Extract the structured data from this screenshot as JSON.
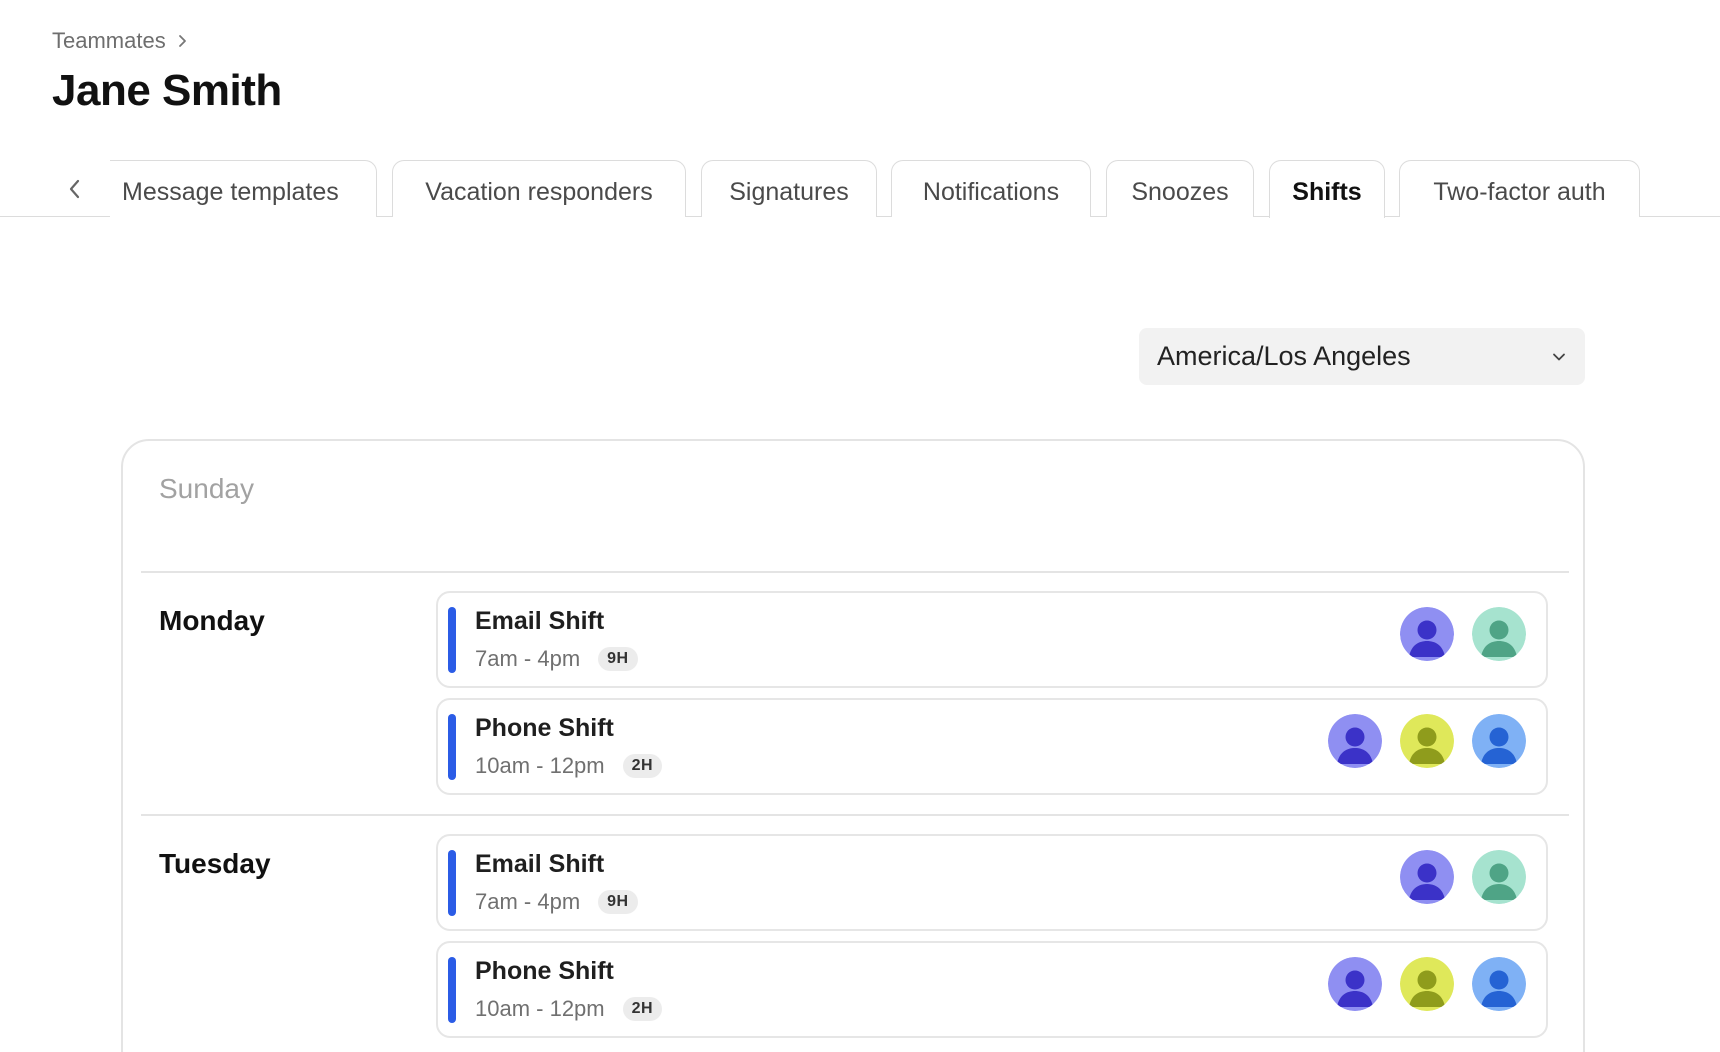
{
  "breadcrumb": {
    "parent": "Teammates"
  },
  "page": {
    "title": "Jane Smith"
  },
  "tabs": [
    {
      "label": "Message templates",
      "active": false
    },
    {
      "label": "Vacation responders",
      "active": false
    },
    {
      "label": "Signatures",
      "active": false
    },
    {
      "label": "Notifications",
      "active": false
    },
    {
      "label": "Snoozes",
      "active": false
    },
    {
      "label": "Shifts",
      "active": true
    },
    {
      "label": "Two-factor auth",
      "active": false
    }
  ],
  "timezone": {
    "value": "America/Los Angeles"
  },
  "schedule": {
    "days": [
      {
        "name": "Sunday",
        "shifts": []
      },
      {
        "name": "Monday",
        "shifts": [
          {
            "title": "Email Shift",
            "time": "7am - 4pm",
            "duration": "9H",
            "avatars": [
              "purple",
              "teal"
            ]
          },
          {
            "title": "Phone Shift",
            "time": "10am - 12pm",
            "duration": "2H",
            "avatars": [
              "purple",
              "lime",
              "blue"
            ]
          }
        ]
      },
      {
        "name": "Tuesday",
        "shifts": [
          {
            "title": "Email Shift",
            "time": "7am - 4pm",
            "duration": "9H",
            "avatars": [
              "purple",
              "teal"
            ]
          },
          {
            "title": "Phone Shift",
            "time": "10am - 12pm",
            "duration": "2H",
            "avatars": [
              "purple",
              "lime",
              "blue"
            ]
          }
        ]
      }
    ]
  },
  "colors": {
    "shift_accent": "#2b5ce6",
    "avatar_purple_bg": "#8f8ff2",
    "avatar_purple_fg": "#3b32c8",
    "avatar_teal_bg": "#a6e3cf",
    "avatar_teal_fg": "#4fa486",
    "avatar_lime_bg": "#dfe85a",
    "avatar_lime_fg": "#8f9c1c",
    "avatar_blue_bg": "#7fb1f5",
    "avatar_blue_fg": "#2563d4"
  },
  "icons": {
    "breadcrumb": "chevron-right-icon",
    "tabs_back": "chevron-left-icon",
    "select": "chevron-down-icon",
    "avatar": "user-icon"
  }
}
